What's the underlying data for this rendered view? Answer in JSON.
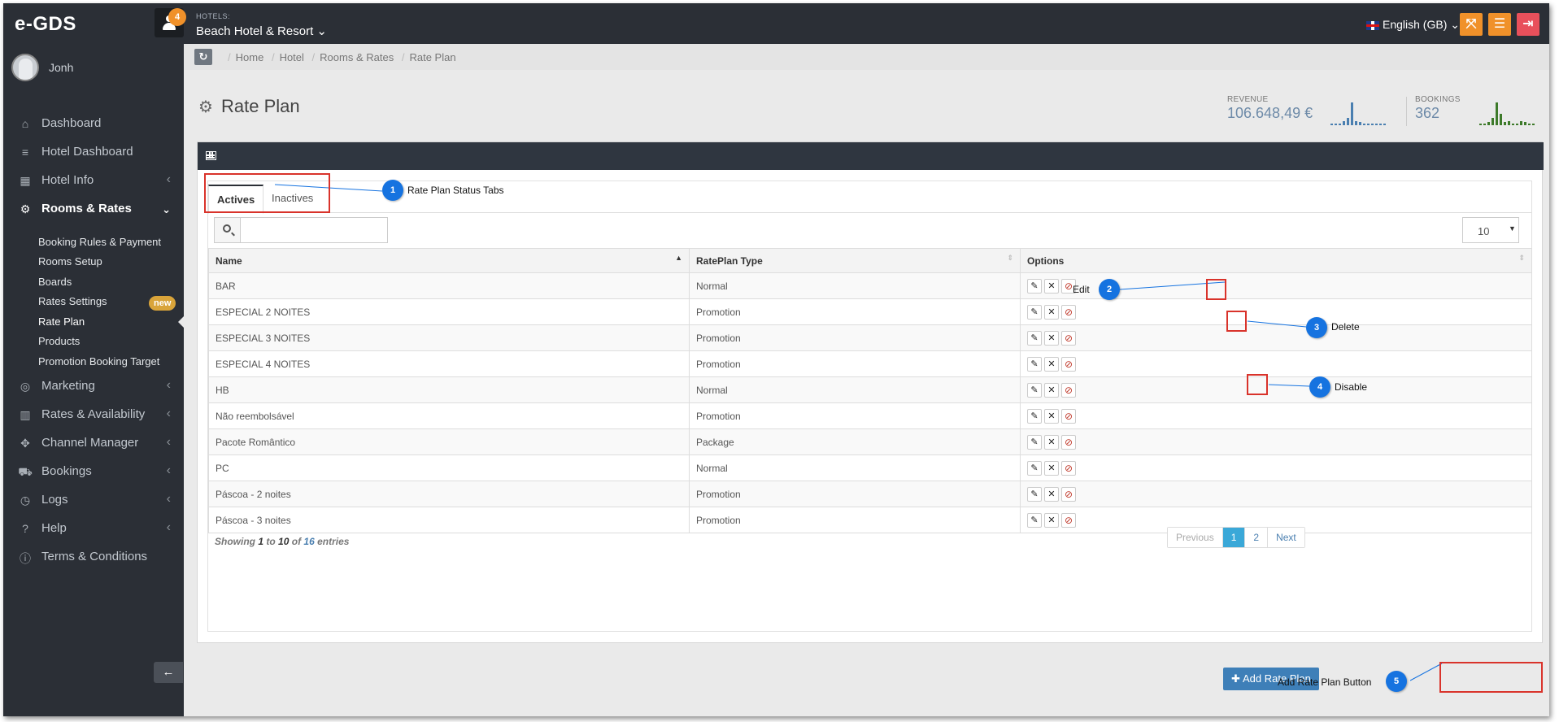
{
  "app": {
    "logo": "e-GDS",
    "notification_count": "4"
  },
  "topbar": {
    "hotels_label": "HOTELS:",
    "hotel_name": "Beach Hotel & Resort",
    "language": "English (GB)"
  },
  "user": {
    "name": "Jonh"
  },
  "sidebar": {
    "items": [
      {
        "label": "Dashboard",
        "icon": "home-icon"
      },
      {
        "label": "Hotel Dashboard",
        "icon": "list-icon"
      },
      {
        "label": "Hotel Info",
        "icon": "building-icon"
      },
      {
        "label": "Rooms & Rates",
        "icon": "cogs-icon"
      },
      {
        "label": "Marketing",
        "icon": "bullseye-icon"
      },
      {
        "label": "Rates & Availability",
        "icon": "bar-chart-icon"
      },
      {
        "label": "Channel Manager",
        "icon": "arrows-icon"
      },
      {
        "label": "Bookings",
        "icon": "cart-icon"
      },
      {
        "label": "Logs",
        "icon": "clock-icon"
      },
      {
        "label": "Help",
        "icon": "question-icon"
      },
      {
        "label": "Terms & Conditions",
        "icon": "info-icon"
      }
    ],
    "subitems": [
      {
        "label": "Booking Rules & Payment"
      },
      {
        "label": "Rooms Setup"
      },
      {
        "label": "Boards"
      },
      {
        "label": "Rates Settings",
        "badge": "new"
      },
      {
        "label": "Rate Plan"
      },
      {
        "label": "Products"
      },
      {
        "label": "Promotion Booking Target"
      }
    ]
  },
  "breadcrumb": [
    "Home",
    "Hotel",
    "Rooms & Rates",
    "Rate Plan"
  ],
  "page": {
    "title": "Rate Plan"
  },
  "stats": {
    "revenue_label": "REVENUE",
    "revenue_value": "106.648,49 €",
    "bookings_label": "BOOKINGS",
    "bookings_value": "362"
  },
  "tabs": {
    "active": "Actives",
    "inactive": "Inactives"
  },
  "search": {
    "placeholder": ""
  },
  "page_length": "10",
  "table": {
    "headers": [
      "Name",
      "RatePlan Type",
      "Options"
    ],
    "rows": [
      {
        "name": "BAR",
        "type": "Normal"
      },
      {
        "name": "ESPECIAL 2 NOITES",
        "type": "Promotion"
      },
      {
        "name": "ESPECIAL 3 NOITES",
        "type": "Promotion"
      },
      {
        "name": "ESPECIAL 4 NOITES",
        "type": "Promotion"
      },
      {
        "name": "HB",
        "type": "Normal"
      },
      {
        "name": "Não reembolsável",
        "type": "Promotion"
      },
      {
        "name": "Pacote Romântico",
        "type": "Package"
      },
      {
        "name": "PC",
        "type": "Normal"
      },
      {
        "name": "Páscoa - 2 noites",
        "type": "Promotion"
      },
      {
        "name": "Páscoa - 3 noites",
        "type": "Promotion"
      }
    ]
  },
  "info": {
    "prefix": "Showing",
    "from": "1",
    "to_word": "to",
    "to": "10",
    "of_word": "of",
    "total": "16",
    "suffix": "entries"
  },
  "pagination": {
    "previous": "Previous",
    "pages": [
      "1",
      "2"
    ],
    "next": "Next"
  },
  "add_button": {
    "label": "Add Rate Plan"
  },
  "annotations": [
    {
      "number": "1",
      "label": "Rate Plan Status Tabs"
    },
    {
      "number": "2",
      "label": "Edit"
    },
    {
      "number": "3",
      "label": "Delete"
    },
    {
      "number": "4",
      "label": "Disable"
    },
    {
      "number": "5",
      "label": "Add Rate Plan Button"
    }
  ],
  "colors": {
    "sidebar_bg": "#2b2f36",
    "accent_orange": "#f0912a",
    "logout_red": "#e8505b",
    "primary_blue": "#3e7fb8",
    "callout_blue": "#1673e0",
    "highlight_red": "#d9332b",
    "sparkline_revenue": "#4a7fb0",
    "sparkline_bookings": "#3d7a2a"
  },
  "sparklines": {
    "revenue": [
      1,
      1,
      1,
      3,
      5,
      16,
      3,
      2,
      1,
      1,
      1,
      1,
      1,
      1
    ],
    "bookings": [
      1,
      1,
      2,
      5,
      16,
      8,
      2,
      3,
      1,
      1,
      3,
      2,
      1,
      1
    ]
  }
}
